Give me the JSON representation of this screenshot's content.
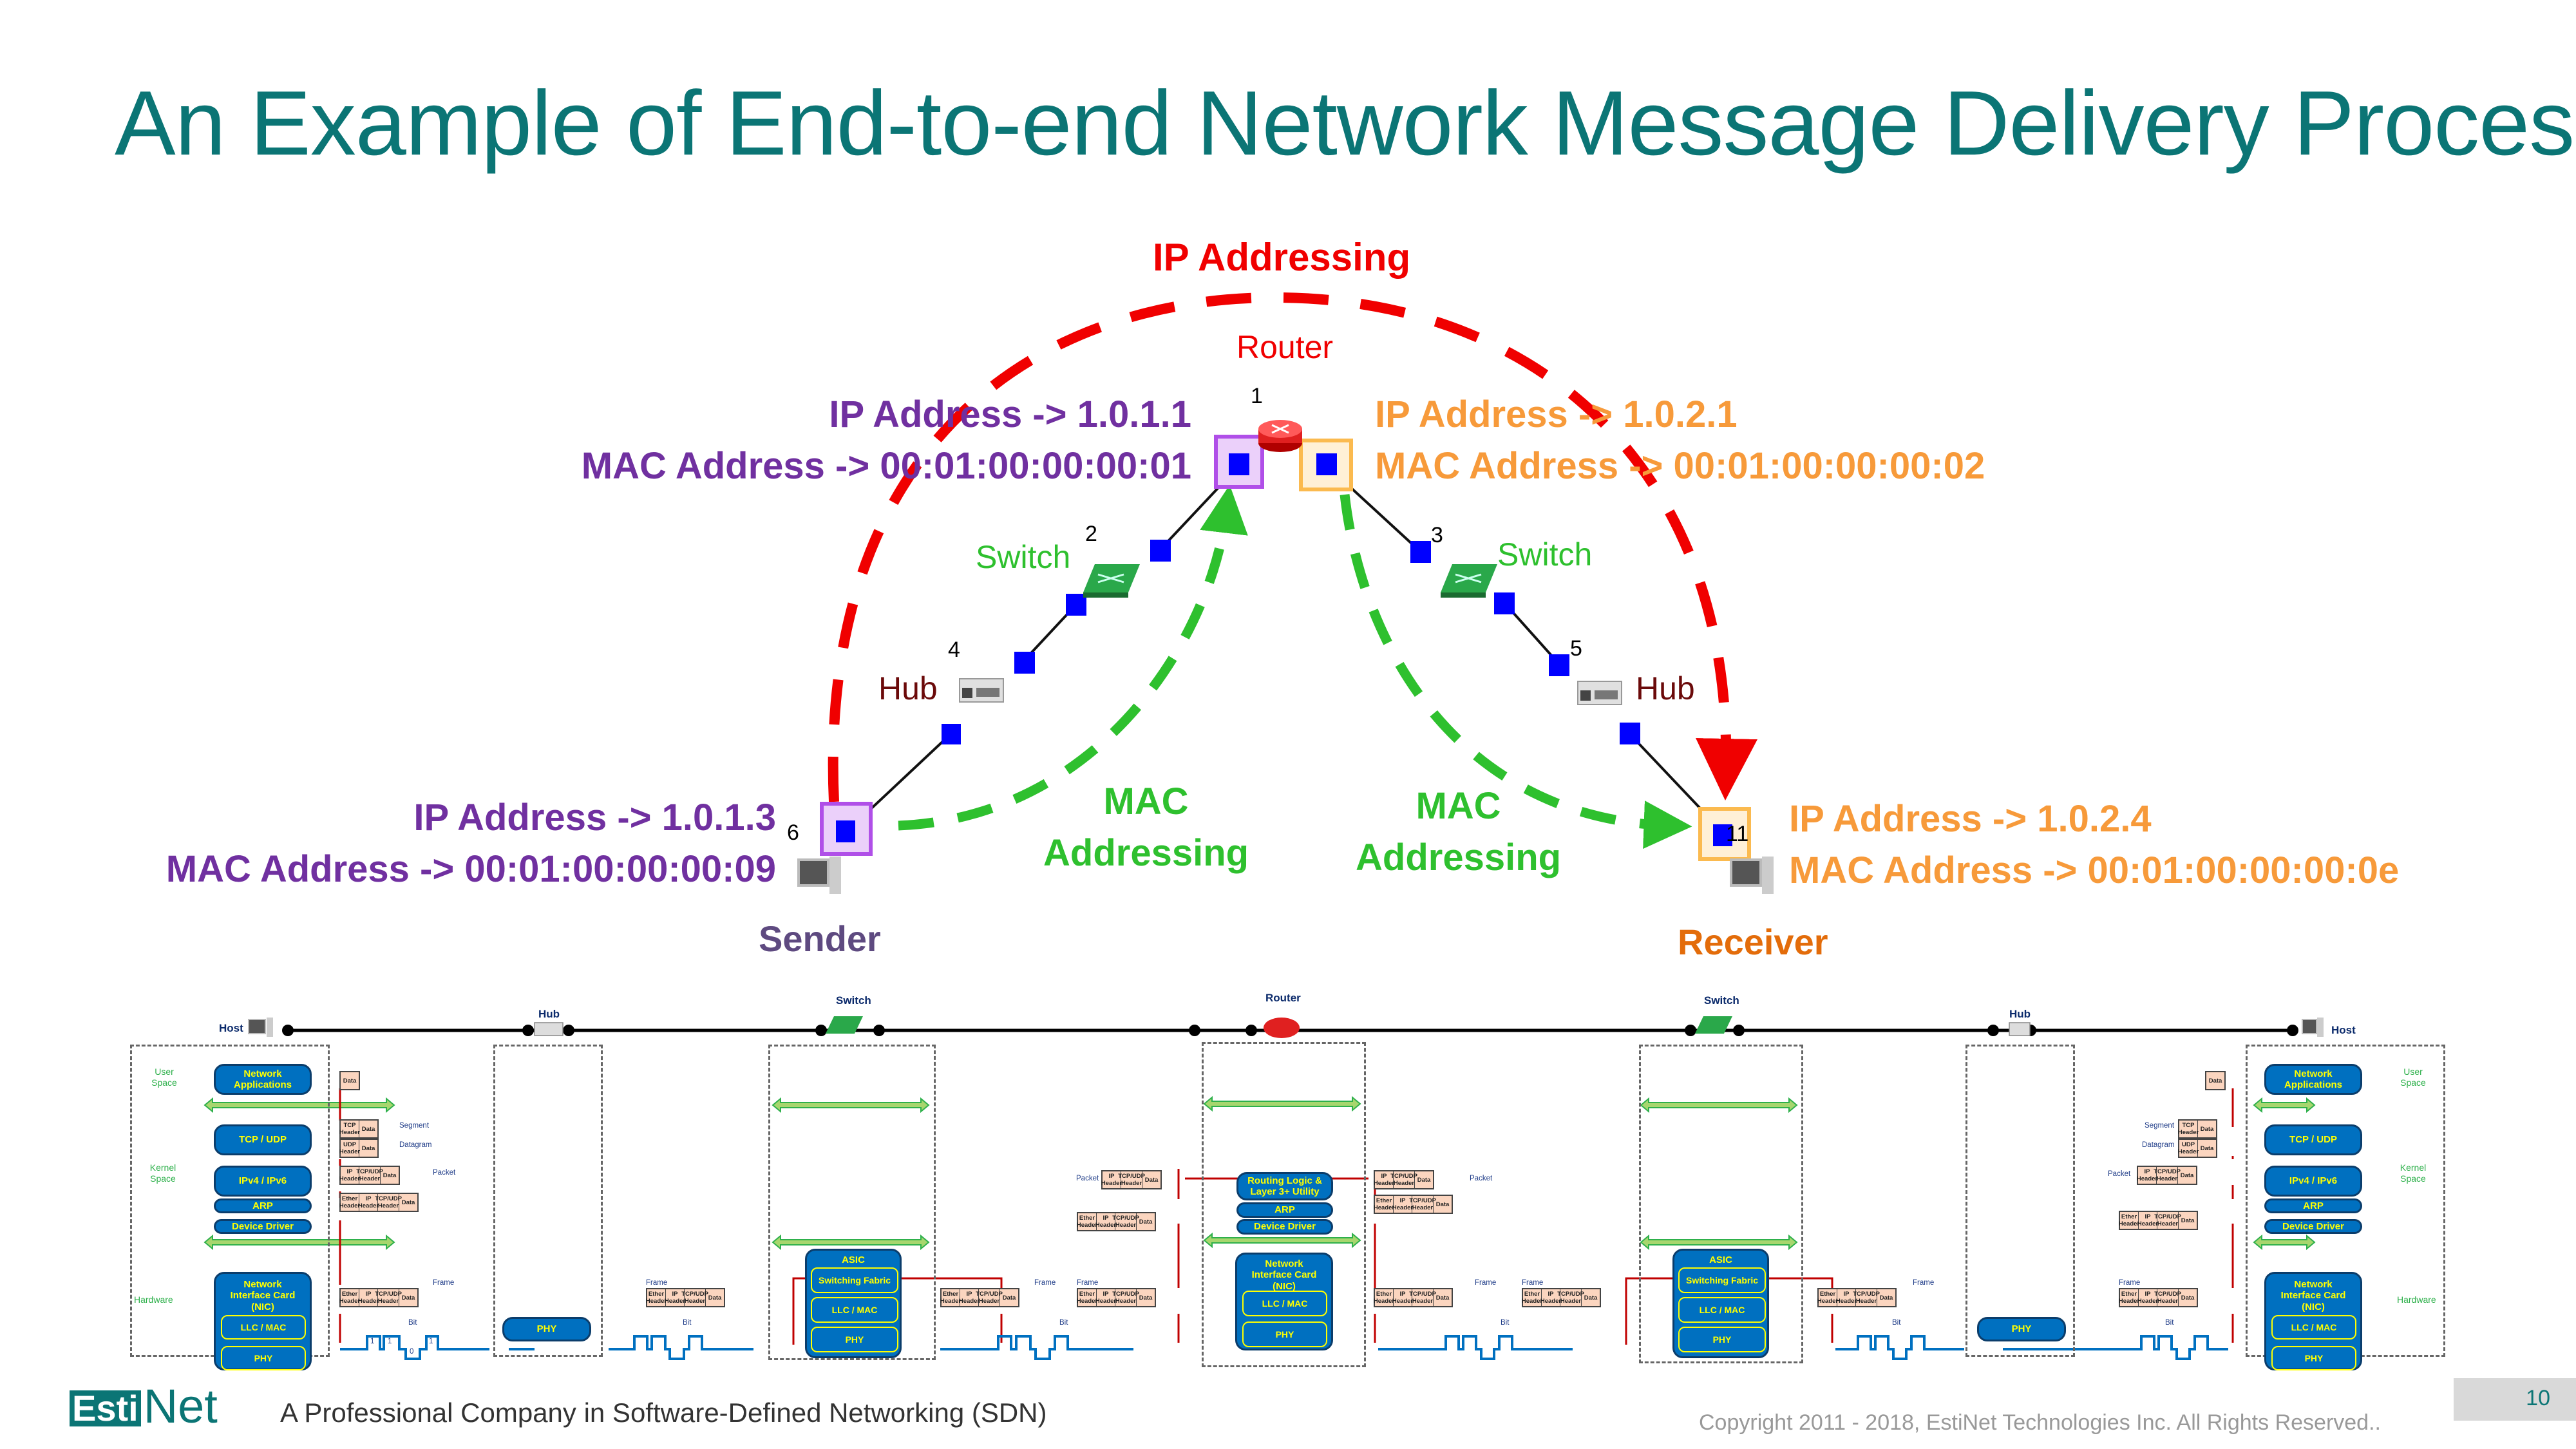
{
  "title": "An Example of End-to-end Network Message Delivery Process",
  "topology": {
    "ip_addressing_label": "IP Addressing",
    "mac_addressing_label_left": [
      "MAC",
      "Addressing"
    ],
    "mac_addressing_label_right": [
      "MAC",
      "Addressing"
    ],
    "router": {
      "label": "Router",
      "node_id": "1"
    },
    "switch_left": {
      "label": "Switch",
      "node_id": "2"
    },
    "switch_right": {
      "label": "Switch",
      "node_id": "3"
    },
    "hub_left": {
      "label": "Hub",
      "node_id": "4"
    },
    "hub_right": {
      "label": "Hub",
      "node_id": "5"
    },
    "sender": {
      "label": "Sender",
      "node_id": "6",
      "ip": "IP Address -> 1.0.1.3",
      "mac": "MAC Address -> 00:01:00:00:00:09"
    },
    "receiver": {
      "label": "Receiver",
      "node_id": "11",
      "ip": "IP Address -> 1.0.2.4",
      "mac": "MAC Address -> 00:01:00:00:00:0e"
    },
    "router_left_iface": {
      "ip": "IP Address -> 1.0.1.1",
      "mac": "MAC Address -> 00:01:00:00:00:01"
    },
    "router_right_iface": {
      "ip": "IP Address -> 1.0.2.1",
      "mac": "MAC Address -> 00:01:00:00:00:02"
    },
    "colors": {
      "ip_path": "#F00000",
      "mac_path": "#2EC02E",
      "left_subnet": "#7030A0",
      "right_subnet": "#F79A3A",
      "title": "#0B7575"
    }
  },
  "stack_diagram": {
    "devices": {
      "host_left": "Host",
      "hub_left": "Hub",
      "switch_left": "Switch",
      "router": "Router",
      "switch_right": "Switch",
      "hub_right": "Hub",
      "host_right": "Host"
    },
    "host_layers": {
      "net_apps": "Network Applications",
      "tcp_udp": "TCP / UDP",
      "ipv": "IPv4 / IPv6",
      "arp": "ARP",
      "driver": "Device Driver",
      "nic": "Network Interface Card (NIC)",
      "llc": "LLC / MAC",
      "phy": "PHY"
    },
    "side_labels": {
      "user": "User Space",
      "kernel": "Kernel Space",
      "hardware": "Hardware"
    },
    "hub_layers": {
      "phy": "PHY"
    },
    "switch_layers": {
      "asic": "ASIC",
      "fabric": "Switching Fabric",
      "llc": "LLC / MAC",
      "phy": "PHY"
    },
    "router_layers": {
      "routing": "Routing Logic & Layer 3+ Utility",
      "arp": "ARP",
      "driver": "Device Driver",
      "nic": "Network Interface Card (NIC)",
      "llc": "LLC / MAC",
      "phy": "PHY"
    },
    "pdu": {
      "data": "Data",
      "tcp_header": "TCP Header",
      "udp_header": "UDP Header",
      "ip_header": "IP Header",
      "tcpudp_header": "TCP/UDP Header",
      "ether_header": "Ether Header",
      "segment": "Segment",
      "datagram": "Datagram",
      "packet": "Packet",
      "frame": "Frame",
      "bit": "Bit",
      "bits": [
        "1",
        "1",
        "0",
        "1"
      ]
    }
  },
  "footer": {
    "logo_left": "Esti",
    "logo_right": "Net",
    "tagline": "A Professional Company in Software-Defined Networking (SDN)",
    "copyright": "Copyright  2011 - 2018, EstiNet Technologies Inc. All Rights Reserved..",
    "page_number": "10"
  }
}
